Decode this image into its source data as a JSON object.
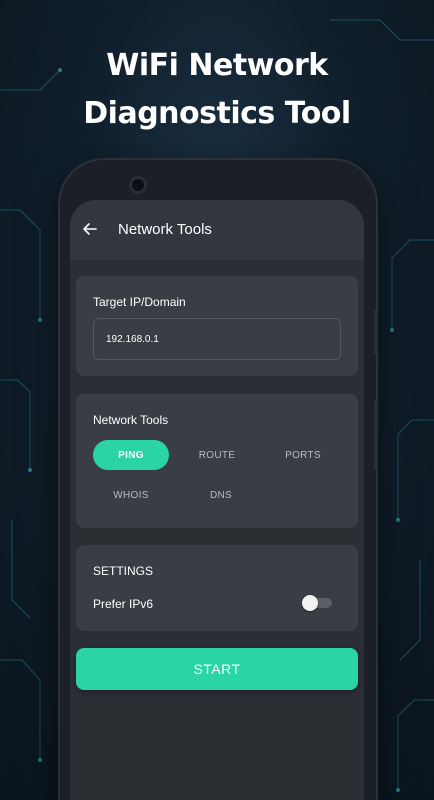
{
  "promo": {
    "headline_line1": "WiFi Network",
    "headline_line2": "Diagnostics Tool"
  },
  "appbar": {
    "back_icon": "arrow-left-icon",
    "title": "Network Tools"
  },
  "target": {
    "label": "Target IP/Domain",
    "value": "192.168.0.1"
  },
  "tools": {
    "label": "Network Tools",
    "options": [
      "PING",
      "ROUTE",
      "PORTS",
      "WHOIS",
      "DNS"
    ],
    "selected": "PING"
  },
  "settings": {
    "label": "SETTINGS",
    "prefer_ipv6_label": "Prefer IPv6",
    "prefer_ipv6": false
  },
  "start_label": "START",
  "colors": {
    "accent": "#2bd4a4",
    "card": "#3a3d43",
    "screen": "#2b2e33",
    "appbar": "#33363c"
  }
}
